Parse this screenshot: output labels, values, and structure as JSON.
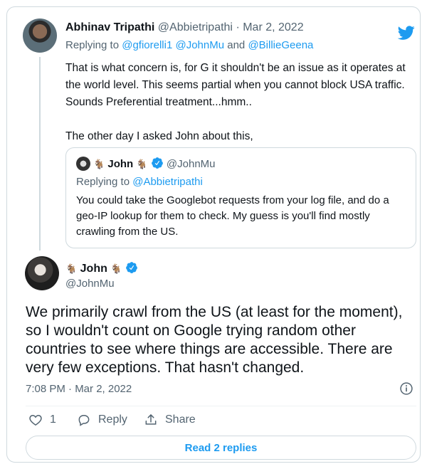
{
  "tweet_parent": {
    "author_name": "Abhinav Tripathi",
    "author_handle": "@Abbietripathi",
    "dot": "·",
    "date": "Mar 2, 2022",
    "replying_prefix": "Replying to",
    "replying_to": "@gfiorelli1 @JohnMu",
    "replying_and": "and",
    "replying_last": "@BillieGeena",
    "body_paragraph_1": "That is what concern is, for G it shouldn't be an issue as it operates at the world level. This seems partial when you cannot block USA traffic. Sounds Preferential treatment...hmm..",
    "body_paragraph_2": "The other day I asked John about this,"
  },
  "quoted_tweet": {
    "author_name": "John",
    "author_handle": "@JohnMu",
    "goat_emoji": "🐐",
    "replying_prefix": "Replying to",
    "replying_to": "@Abbietripathi",
    "body": "You could take the Googlebot requests from your log file, and do a geo-IP lookup for them to check. My guess is you'll find mostly crawling from the US."
  },
  "main_tweet": {
    "author_name": "John",
    "author_handle": "@JohnMu",
    "goat_emoji": "🐐",
    "body": "We primarily crawl from the US (at least for the moment), so I wouldn't count on Google trying random other countries to see where things are accessible. There are very few exceptions. That hasn't changed.",
    "timestamp": "7:08 PM · Mar 2, 2022",
    "like_count": "1",
    "reply_label": "Reply",
    "share_label": "Share",
    "read_replies_label": "Read 2 replies"
  },
  "icons": {
    "brand": "twitter-bird-icon",
    "verified": "verified-badge-icon",
    "info": "info-icon",
    "like": "heart-icon",
    "reply": "reply-bubble-icon",
    "share": "share-icon"
  },
  "colors": {
    "accent": "#1d9bf0",
    "muted": "#536471",
    "border": "#cfd9de",
    "text": "#0f1419"
  }
}
